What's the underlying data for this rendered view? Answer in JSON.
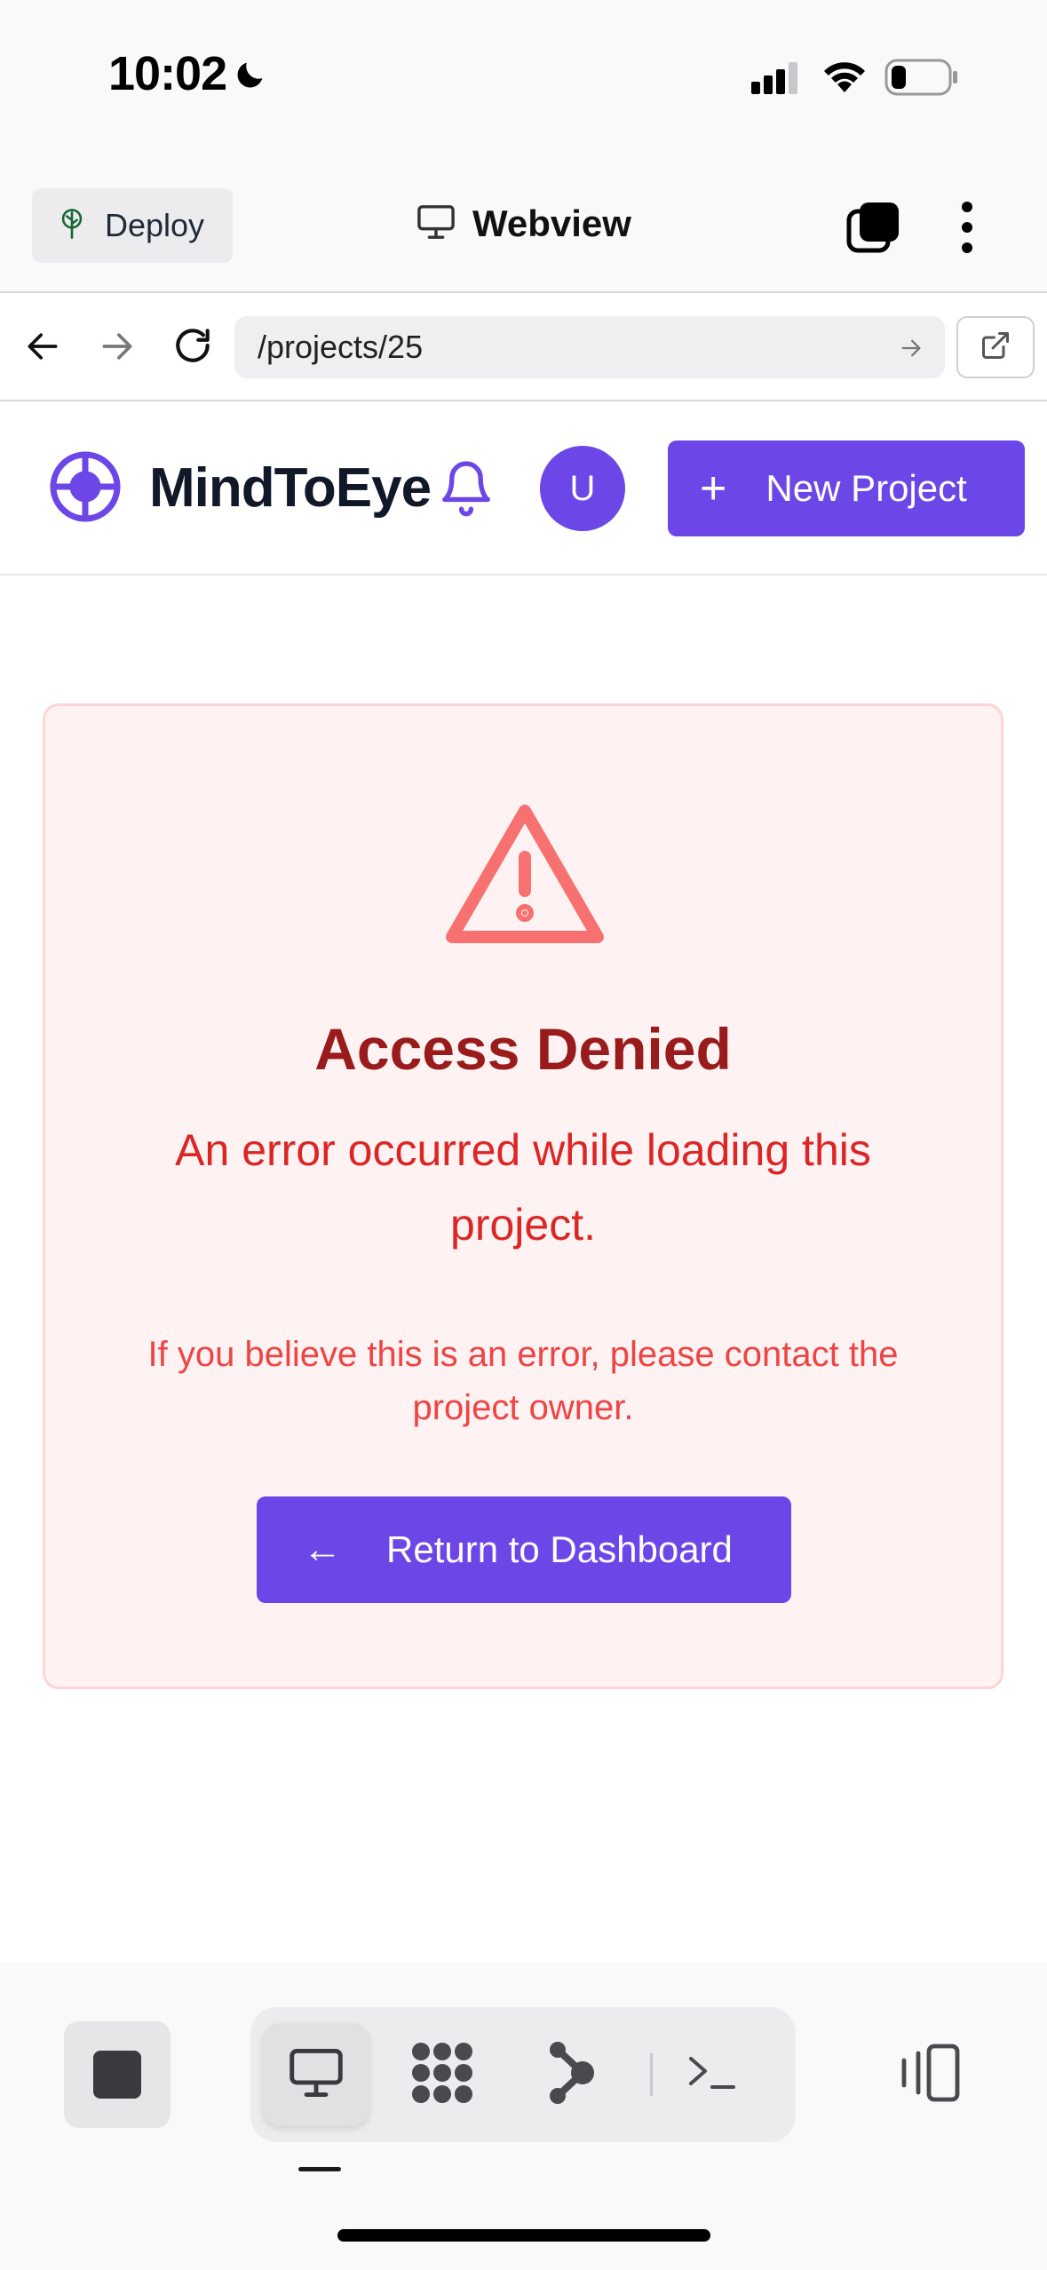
{
  "status_bar": {
    "time": "10:02"
  },
  "app_header": {
    "deploy_label": "Deploy",
    "title": "Webview"
  },
  "browser": {
    "url": "/projects/25"
  },
  "site_header": {
    "brand": "MindToEye",
    "avatar_initial": "U",
    "new_project_label": "New Project",
    "new_project_icon": "+"
  },
  "error": {
    "title": "Access Denied",
    "message": "An error occurred while loading this project.",
    "hint": "If you believe this is an error, please contact the project owner.",
    "button_label": "Return to Dashboard",
    "button_icon": "←"
  },
  "colors": {
    "accent": "#6d46e7",
    "error_title": "#991b1b",
    "error_text": "#dc2626",
    "error_bg": "#fef2f3",
    "warning_icon": "#f87171"
  },
  "bottom_toolbar": {
    "icons": [
      "stop-icon",
      "monitor-icon",
      "grid-dots-icon",
      "branch-icon",
      "terminal-icon",
      "device-switch-icon"
    ]
  }
}
